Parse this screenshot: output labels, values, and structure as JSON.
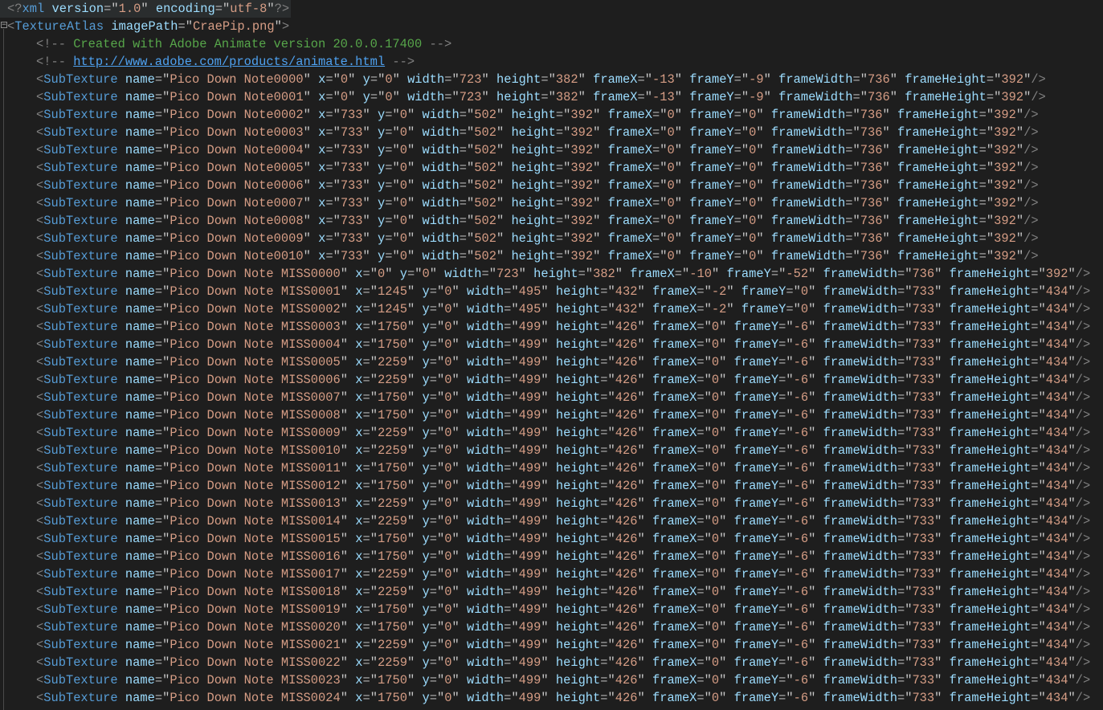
{
  "editor": {
    "prolog": {
      "name": "xml",
      "attrs": [
        [
          "version",
          "1.0"
        ],
        [
          "encoding",
          "utf-8"
        ]
      ]
    },
    "root": {
      "tag": "TextureAtlas",
      "attrs": [
        [
          "imagePath",
          "CraePip.png"
        ]
      ]
    },
    "comments": [
      {
        "text": "Created with Adobe Animate version 20.0.0.17400"
      },
      {
        "link": "http://www.adobe.com/products/animate.html"
      }
    ],
    "subtexture_tag": "SubTexture",
    "columns": [
      "name",
      "x",
      "y",
      "width",
      "height",
      "frameX",
      "frameY",
      "frameWidth",
      "frameHeight"
    ],
    "rows": [
      [
        "Pico Down Note0000",
        "0",
        "0",
        "723",
        "382",
        "-13",
        "-9",
        "736",
        "392"
      ],
      [
        "Pico Down Note0001",
        "0",
        "0",
        "723",
        "382",
        "-13",
        "-9",
        "736",
        "392"
      ],
      [
        "Pico Down Note0002",
        "733",
        "0",
        "502",
        "392",
        "0",
        "0",
        "736",
        "392"
      ],
      [
        "Pico Down Note0003",
        "733",
        "0",
        "502",
        "392",
        "0",
        "0",
        "736",
        "392"
      ],
      [
        "Pico Down Note0004",
        "733",
        "0",
        "502",
        "392",
        "0",
        "0",
        "736",
        "392"
      ],
      [
        "Pico Down Note0005",
        "733",
        "0",
        "502",
        "392",
        "0",
        "0",
        "736",
        "392"
      ],
      [
        "Pico Down Note0006",
        "733",
        "0",
        "502",
        "392",
        "0",
        "0",
        "736",
        "392"
      ],
      [
        "Pico Down Note0007",
        "733",
        "0",
        "502",
        "392",
        "0",
        "0",
        "736",
        "392"
      ],
      [
        "Pico Down Note0008",
        "733",
        "0",
        "502",
        "392",
        "0",
        "0",
        "736",
        "392"
      ],
      [
        "Pico Down Note0009",
        "733",
        "0",
        "502",
        "392",
        "0",
        "0",
        "736",
        "392"
      ],
      [
        "Pico Down Note0010",
        "733",
        "0",
        "502",
        "392",
        "0",
        "0",
        "736",
        "392"
      ],
      [
        "Pico Down Note MISS0000",
        "0",
        "0",
        "723",
        "382",
        "-10",
        "-52",
        "736",
        "392"
      ],
      [
        "Pico Down Note MISS0001",
        "1245",
        "0",
        "495",
        "432",
        "-2",
        "0",
        "733",
        "434"
      ],
      [
        "Pico Down Note MISS0002",
        "1245",
        "0",
        "495",
        "432",
        "-2",
        "0",
        "733",
        "434"
      ],
      [
        "Pico Down Note MISS0003",
        "1750",
        "0",
        "499",
        "426",
        "0",
        "-6",
        "733",
        "434"
      ],
      [
        "Pico Down Note MISS0004",
        "1750",
        "0",
        "499",
        "426",
        "0",
        "-6",
        "733",
        "434"
      ],
      [
        "Pico Down Note MISS0005",
        "2259",
        "0",
        "499",
        "426",
        "0",
        "-6",
        "733",
        "434"
      ],
      [
        "Pico Down Note MISS0006",
        "2259",
        "0",
        "499",
        "426",
        "0",
        "-6",
        "733",
        "434"
      ],
      [
        "Pico Down Note MISS0007",
        "1750",
        "0",
        "499",
        "426",
        "0",
        "-6",
        "733",
        "434"
      ],
      [
        "Pico Down Note MISS0008",
        "1750",
        "0",
        "499",
        "426",
        "0",
        "-6",
        "733",
        "434"
      ],
      [
        "Pico Down Note MISS0009",
        "2259",
        "0",
        "499",
        "426",
        "0",
        "-6",
        "733",
        "434"
      ],
      [
        "Pico Down Note MISS0010",
        "2259",
        "0",
        "499",
        "426",
        "0",
        "-6",
        "733",
        "434"
      ],
      [
        "Pico Down Note MISS0011",
        "1750",
        "0",
        "499",
        "426",
        "0",
        "-6",
        "733",
        "434"
      ],
      [
        "Pico Down Note MISS0012",
        "1750",
        "0",
        "499",
        "426",
        "0",
        "-6",
        "733",
        "434"
      ],
      [
        "Pico Down Note MISS0013",
        "2259",
        "0",
        "499",
        "426",
        "0",
        "-6",
        "733",
        "434"
      ],
      [
        "Pico Down Note MISS0014",
        "2259",
        "0",
        "499",
        "426",
        "0",
        "-6",
        "733",
        "434"
      ],
      [
        "Pico Down Note MISS0015",
        "1750",
        "0",
        "499",
        "426",
        "0",
        "-6",
        "733",
        "434"
      ],
      [
        "Pico Down Note MISS0016",
        "1750",
        "0",
        "499",
        "426",
        "0",
        "-6",
        "733",
        "434"
      ],
      [
        "Pico Down Note MISS0017",
        "2259",
        "0",
        "499",
        "426",
        "0",
        "-6",
        "733",
        "434"
      ],
      [
        "Pico Down Note MISS0018",
        "2259",
        "0",
        "499",
        "426",
        "0",
        "-6",
        "733",
        "434"
      ],
      [
        "Pico Down Note MISS0019",
        "1750",
        "0",
        "499",
        "426",
        "0",
        "-6",
        "733",
        "434"
      ],
      [
        "Pico Down Note MISS0020",
        "1750",
        "0",
        "499",
        "426",
        "0",
        "-6",
        "733",
        "434"
      ],
      [
        "Pico Down Note MISS0021",
        "2259",
        "0",
        "499",
        "426",
        "0",
        "-6",
        "733",
        "434"
      ],
      [
        "Pico Down Note MISS0022",
        "2259",
        "0",
        "499",
        "426",
        "0",
        "-6",
        "733",
        "434"
      ],
      [
        "Pico Down Note MISS0023",
        "1750",
        "0",
        "499",
        "426",
        "0",
        "-6",
        "733",
        "434"
      ],
      [
        "Pico Down Note MISS0024",
        "1750",
        "0",
        "499",
        "426",
        "0",
        "-6",
        "733",
        "434"
      ]
    ]
  }
}
